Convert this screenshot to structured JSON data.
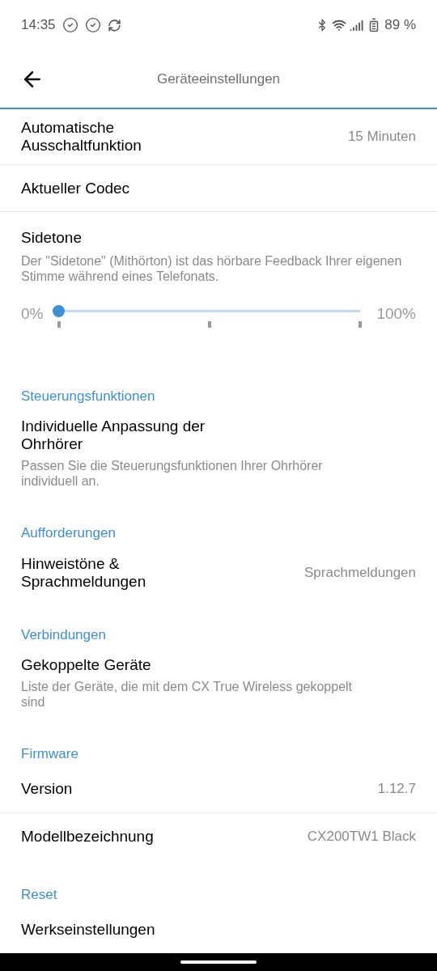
{
  "status_bar": {
    "time": "14:35",
    "battery": "89 %"
  },
  "header": {
    "title": "Geräteeinstellungen"
  },
  "sections": [
    {
      "items": [
        {
          "kind": "value",
          "title": "Automatische Ausschaltfunktion",
          "value": "15 Minuten"
        },
        {
          "kind": "plain",
          "title": "Aktueller Codec"
        },
        {
          "kind": "slider",
          "title": "Sidetone",
          "description": "Der \"Sidetone\" (Mithörton) ist das hörbare Feedback Ihrer eigenen Stimme während eines Telefonats.",
          "level": 0,
          "min_label": "0%",
          "max_label": "100%"
        }
      ]
    },
    {
      "heading": "Steuerungsfunktionen",
      "items": [
        {
          "kind": "plain",
          "title": "Individuelle Anpassung der Ohrhörer",
          "description": "Passen Sie die Steuerungsfunktionen Ihrer Ohrhörer individuell an."
        }
      ]
    },
    {
      "heading": "Aufforderungen",
      "items": [
        {
          "kind": "value",
          "title": "Hinweistöne & Sprachmeldungen",
          "value": "Sprachmeldungen"
        }
      ]
    },
    {
      "heading": "Verbindungen",
      "items": [
        {
          "kind": "plain",
          "title": "Gekoppelte Geräte",
          "description": "Liste der Geräte, die mit dem CX True Wireless gekoppelt sind"
        }
      ]
    },
    {
      "heading": "Firmware",
      "items": [
        {
          "kind": "value",
          "title": "Version",
          "value": "1.12.7"
        },
        {
          "kind": "value",
          "title": "Modellbezeichnung",
          "value": "CX200TW1 Black"
        }
      ]
    },
    {
      "heading": "Reset",
      "items": [
        {
          "kind": "plain",
          "title": "Werkseinstellungen"
        }
      ]
    }
  ]
}
